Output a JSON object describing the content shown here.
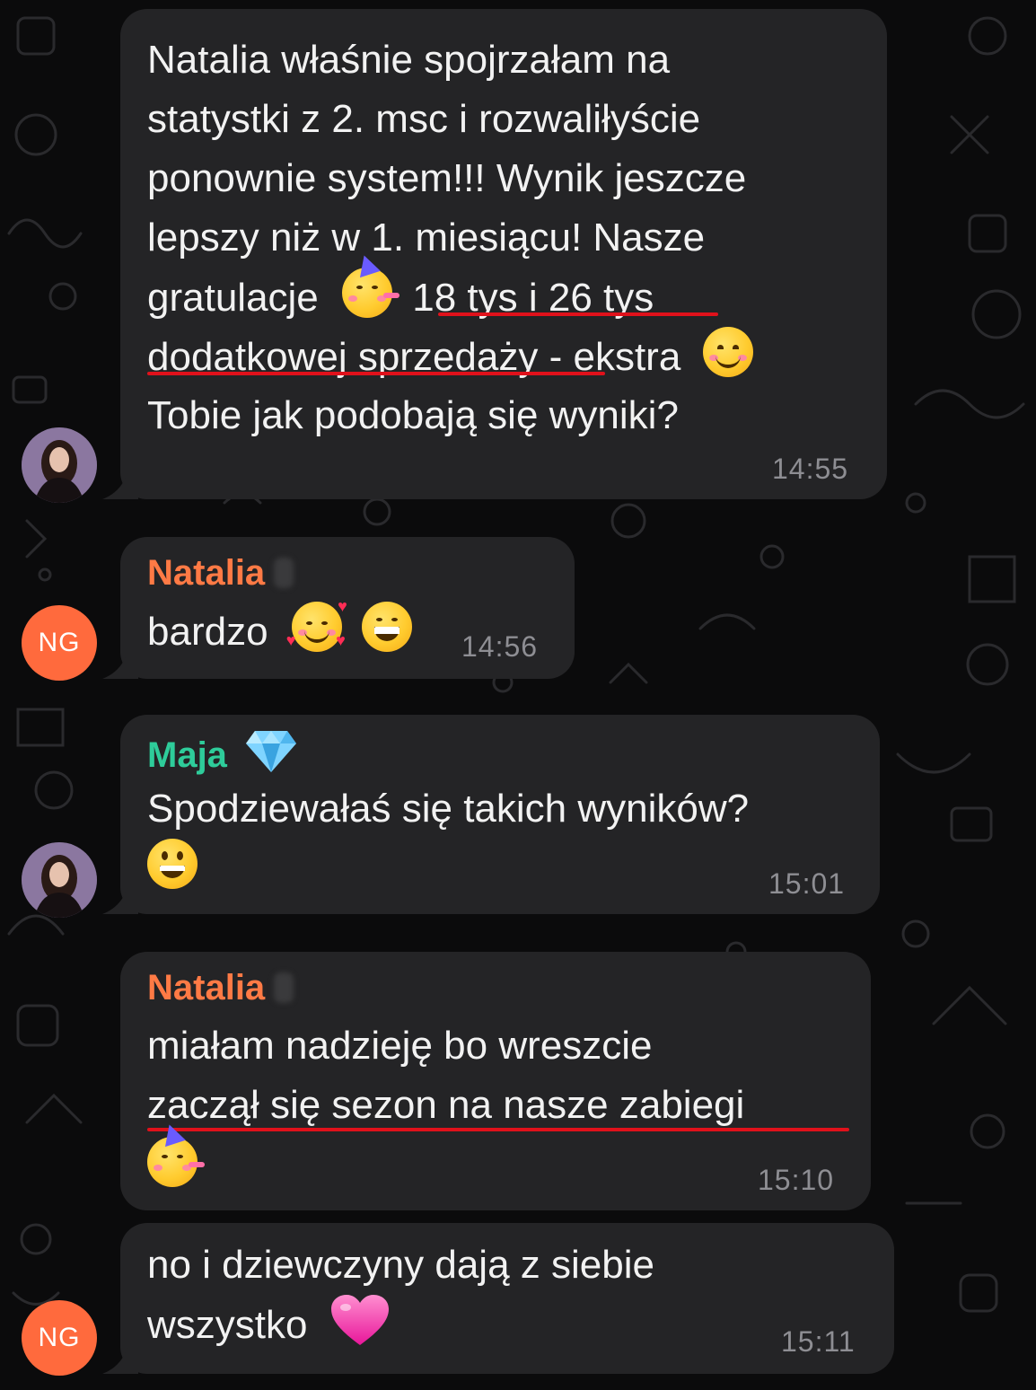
{
  "colors": {
    "background": "#0b0b0c",
    "bubble": "#242426",
    "sender_natalia": "#ff7a45",
    "sender_maja": "#2ecc9a",
    "underline": "#e0111b",
    "avatar_ng": "#ff6a3d",
    "timestamp": "#8e8e93"
  },
  "messages": [
    {
      "lines": [
        "Natalia właśnie spojrzałam na",
        "statystki z 2. msc i rozwaliłyście",
        "ponownie system!!! Wynik jeszcze",
        "lepszy niż w 1. miesiącu! Nasze",
        "gratulacje",
        "18 tys i 26 tys",
        "dodatkowej sprzedaży",
        "- ekstra",
        "Tobie jak podobają się wyniki?"
      ],
      "time": "14:55",
      "avatar": "photo",
      "emojis": [
        "partying-face-emoji",
        "smiling-face-emoji"
      ]
    },
    {
      "sender": "Natalia",
      "text": "bardzo",
      "time": "14:56",
      "avatar_initials": "NG",
      "emojis": [
        "smiling-face-with-hearts-emoji",
        "grinning-face-emoji"
      ]
    },
    {
      "sender": "Maja",
      "sender_badge": "gem-stone-emoji",
      "text": "Spodziewałaś się takich wyników?",
      "time": "15:01",
      "avatar": "photo",
      "emojis": [
        "grinning-face-emoji"
      ]
    },
    {
      "sender": "Natalia",
      "lines": [
        "miałam nadzieję bo wreszcie",
        "zaczął się sezon na nasze zabiegi"
      ],
      "time": "15:10",
      "emojis": [
        "partying-face-emoji"
      ]
    },
    {
      "lines": [
        "no i dziewczyny dają z siebie",
        "wszystko"
      ],
      "time": "15:11",
      "avatar_initials": "NG",
      "emojis": [
        "pink-heart-emoji"
      ]
    }
  ]
}
